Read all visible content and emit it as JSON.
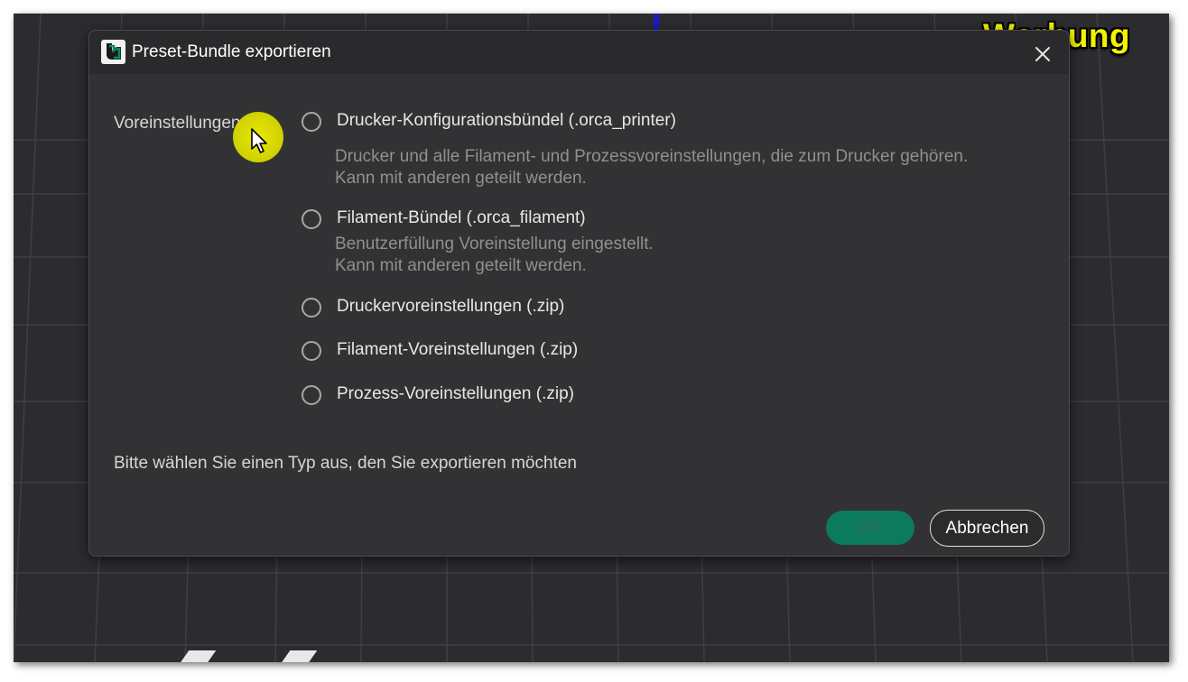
{
  "overlay": {
    "ad_label": "Werbung"
  },
  "dialog": {
    "title": "Preset-Bundle exportieren",
    "section_label": "Voreinstellungen",
    "options": [
      {
        "label": "Drucker-Konfigurationsbündel (.orca_printer)",
        "description": [
          "Drucker und alle Filament- und Prozessvoreinstellungen, die zum Drucker gehören.",
          "Kann mit anderen geteilt werden."
        ],
        "selected": false
      },
      {
        "label": "Filament-Bündel (.orca_filament)",
        "description": [
          "Benutzerfüllung Voreinstellung eingestellt.",
          "Kann mit anderen geteilt werden."
        ],
        "selected": false
      },
      {
        "label": "Druckervoreinstellungen (.zip)",
        "selected": false
      },
      {
        "label": "Filament-Voreinstellungen (.zip)",
        "selected": false
      },
      {
        "label": "Prozess-Voreinstellungen (.zip)",
        "selected": false
      }
    ],
    "hint": "Bitte wählen Sie einen Typ aus, den Sie exportieren möchten",
    "buttons": {
      "ok": "OK",
      "cancel": "Abbrechen"
    }
  },
  "icons": {
    "app": "orca-slicer-logo-icon",
    "close": "close-icon",
    "cursor": "mouse-cursor-icon"
  },
  "colors": {
    "dialog_bg": "#323234",
    "titlebar_bg": "#2a2a2c",
    "ok_button": "#0c7a5e",
    "ad_label": "#f3f300",
    "cursor_highlight": "#e6e600"
  }
}
